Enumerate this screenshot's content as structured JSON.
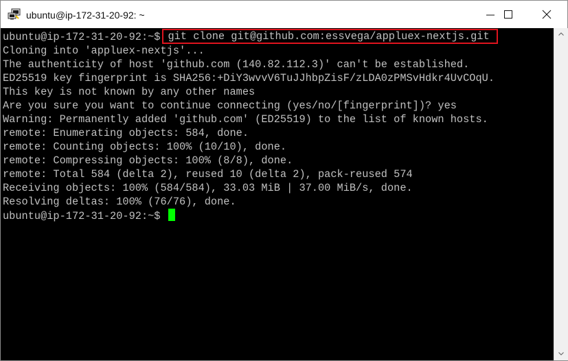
{
  "window": {
    "title": "ubuntu@ip-172-31-20-92: ~"
  },
  "icons": {
    "app": "putty-icon",
    "minimize": "minimize-icon",
    "maximize": "maximize-icon",
    "close": "close-icon"
  },
  "colors": {
    "terminal_bg": "#000000",
    "terminal_text": "#c0c0c0",
    "cursor": "#00ff00",
    "highlight_border": "#e0141e"
  },
  "terminal": {
    "prompt": "ubuntu@ip-172-31-20-92:~$",
    "command": "git clone git@github.com:essvega/appluex-nextjs.git",
    "output": [
      "Cloning into 'appluex-nextjs'...",
      "The authenticity of host 'github.com (140.82.112.3)' can't be established.",
      "ED25519 key fingerprint is SHA256:+DiY3wvvV6TuJJhbpZisF/zLDA0zPMSvHdkr4UvCOqU.",
      "This key is not known by any other names",
      "Are you sure you want to continue connecting (yes/no/[fingerprint])? yes",
      "Warning: Permanently added 'github.com' (ED25519) to the list of known hosts.",
      "remote: Enumerating objects: 584, done.",
      "remote: Counting objects: 100% (10/10), done.",
      "remote: Compressing objects: 100% (8/8), done.",
      "remote: Total 584 (delta 2), reused 10 (delta 2), pack-reused 574",
      "Receiving objects: 100% (584/584), 33.03 MiB | 37.00 MiB/s, done.",
      "Resolving deltas: 100% (76/76), done."
    ],
    "final_prompt": "ubuntu@ip-172-31-20-92:~$"
  }
}
